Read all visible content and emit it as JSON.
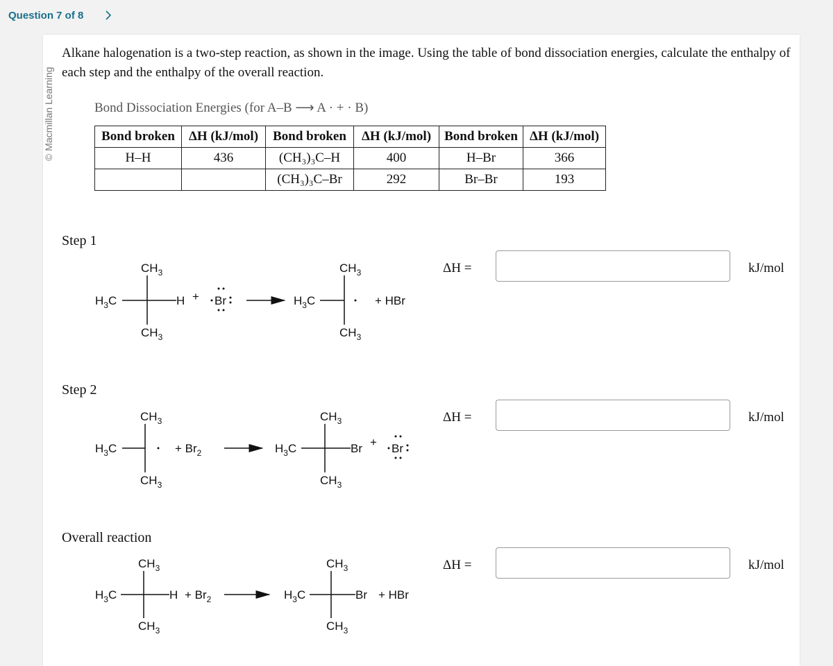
{
  "header": {
    "question_label": "Question 7 of 8",
    "next_icon": "chevron-right-icon"
  },
  "watermark": "© Macmillan Learning",
  "prompt": "Alkane halogenation is a two-step reaction, as shown in the image. Using the table of bond dissociation energies, calculate the enthalpy of each step and the enthalpy of the overall reaction.",
  "table": {
    "caption": "Bond Dissociation Energies (for A–B ⟶ A · + · B)",
    "headers": [
      "Bond broken",
      "ΔH (kJ/mol)",
      "Bond broken",
      "ΔH (kJ/mol)",
      "Bond broken",
      "ΔH (kJ/mol)"
    ],
    "rows": [
      [
        "H–H",
        "436",
        "(CH₃)₃C–H",
        "400",
        "H–Br",
        "366"
      ],
      [
        "",
        "",
        "(CH₃)₃C–Br",
        "292",
        "Br–Br",
        "193"
      ]
    ]
  },
  "steps": [
    {
      "label": "Step 1",
      "reactant1": {
        "left": "H3C",
        "top": "CH3",
        "bottom": "CH3",
        "right": "H"
      },
      "reactant2": "Br radical",
      "product1": {
        "left": "H3C",
        "top": "CH3",
        "bottom": "CH3",
        "right": "radical"
      },
      "product2": "+ HBr",
      "answer": {
        "label": "ΔH =",
        "value": "",
        "unit": "kJ/mol"
      }
    },
    {
      "label": "Step 2",
      "reactant1": {
        "left": "H3C",
        "top": "CH3",
        "bottom": "CH3",
        "right": "radical"
      },
      "reactant2": "+ Br2",
      "product1": {
        "left": "H3C",
        "top": "CH3",
        "bottom": "CH3",
        "right": "Br"
      },
      "product2": "Br radical",
      "answer": {
        "label": "ΔH =",
        "value": "",
        "unit": "kJ/mol"
      }
    },
    {
      "label": "Overall reaction",
      "reactant1": {
        "left": "H3C",
        "top": "CH3",
        "bottom": "CH3",
        "right": "H"
      },
      "reactant2": "+ Br2",
      "product1": {
        "left": "H3C",
        "top": "CH3",
        "bottom": "CH3",
        "right": "Br"
      },
      "product2": "+ HBr",
      "answer": {
        "label": "ΔH =",
        "value": "",
        "unit": "kJ/mol"
      }
    }
  ],
  "chem": {
    "H3C": "H",
    "C": "C",
    "CH": "CH",
    "sub3": "3",
    "sub2": "2",
    "H": "H",
    "Br": "Br",
    "plus": "+",
    "HBr": "+ HBr",
    "Br2": "+ Br",
    "dot": "·",
    "colon": ":"
  }
}
